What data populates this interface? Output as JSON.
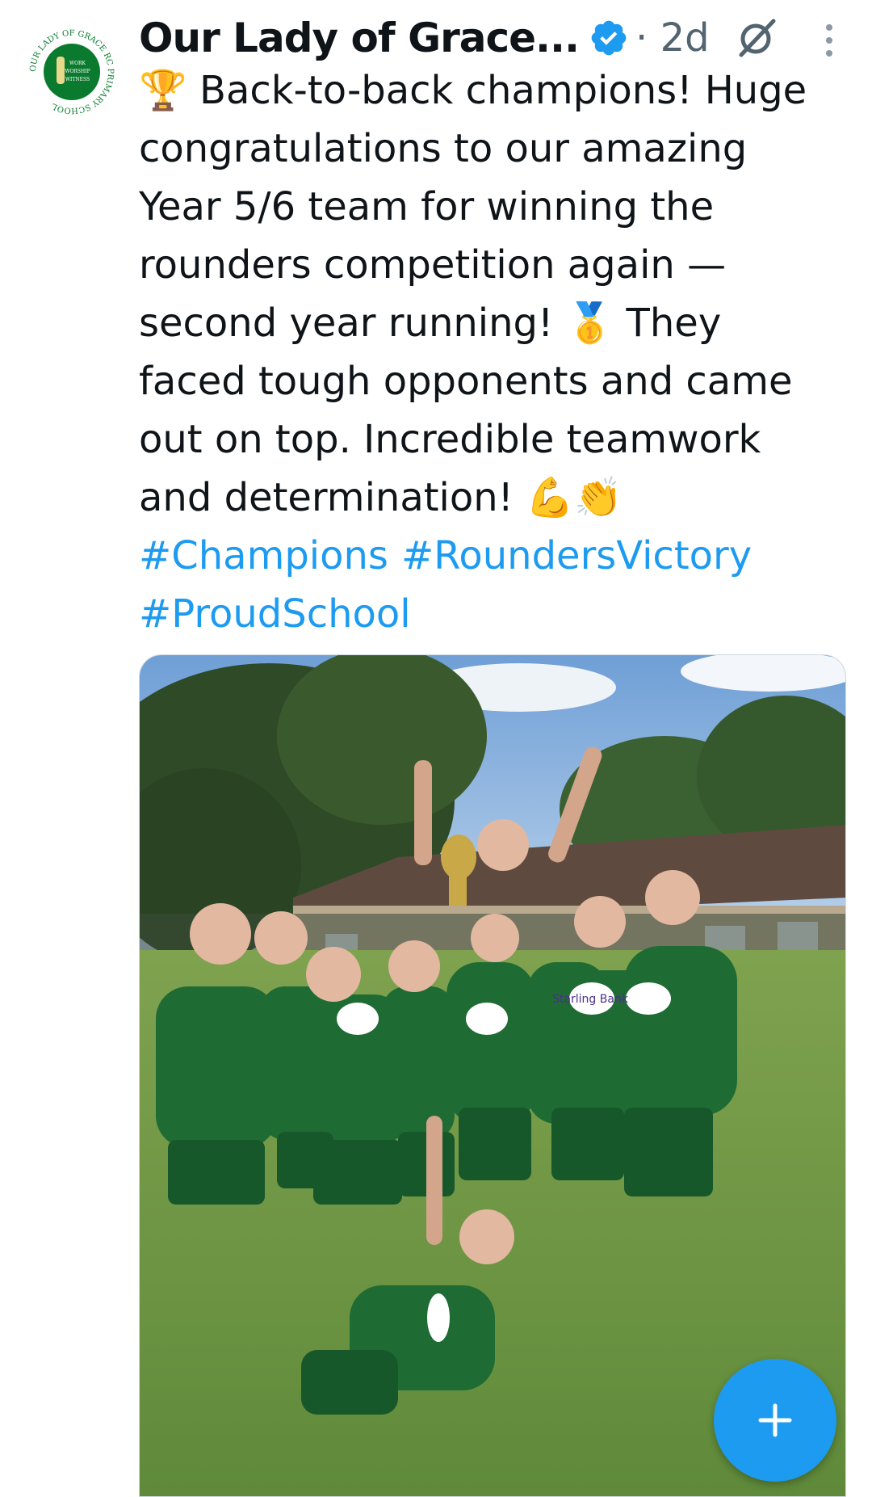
{
  "post": {
    "author_name": "Our Lady of Grace...",
    "time_meta": "· 2d",
    "avatar_ring_text": "OUR LADY OF GRACE RC PRIMARY SCHOOL",
    "avatar_center_text": [
      "WORK",
      "WORSHIP",
      "WITNESS"
    ],
    "text": "🏆 Back-to-back champions! Huge\ncongratulations to our amazing\nYear 5/6 team for winning the\nrounders competition again —\nsecond year running! 🥇 They\nfaced tough opponents and came\nout on top. Incredible teamwork\nand determination! 💪👏",
    "hashtags": [
      "#Champions",
      "#RoundersVictory",
      "#ProudSchool"
    ],
    "photo_alt": "",
    "shirt_sponsor_text": "Starling Bank"
  },
  "icons": {
    "verified": "verified-badge-icon",
    "grok": "grok-icon",
    "more": "more-vertical-icon",
    "compose": "plus-icon"
  },
  "colors": {
    "accent": "#1d9bf0",
    "text": "#0f1419",
    "secondary": "#536471",
    "avatar_green": "#0a7a2e"
  }
}
